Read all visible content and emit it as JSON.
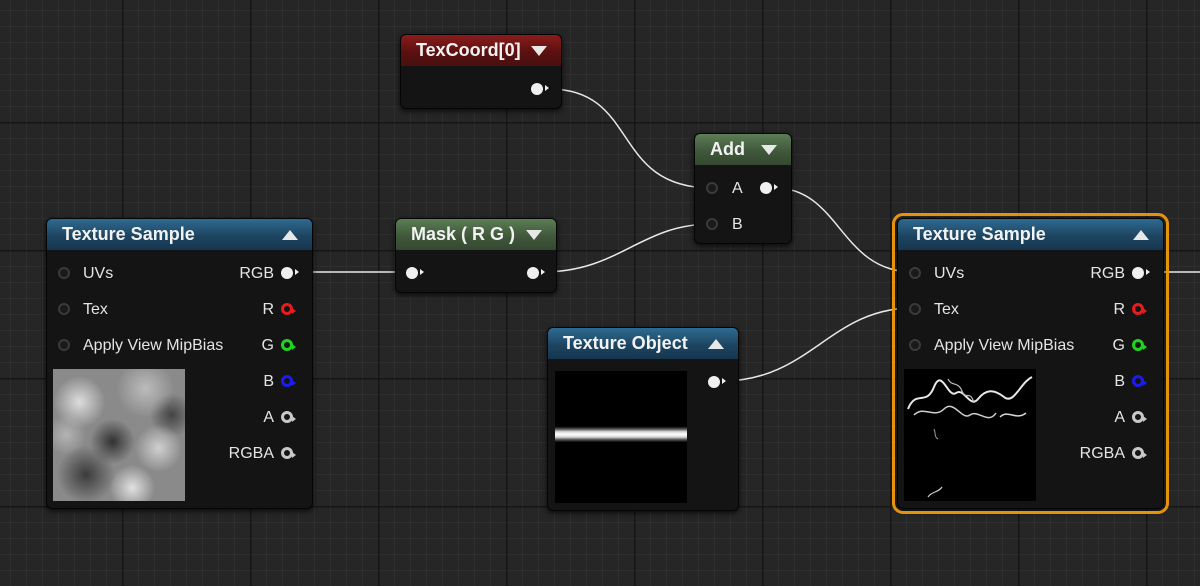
{
  "colors": {
    "rgb_pin": "#f0f0f0",
    "r_pin": "#e81c1c",
    "g_pin": "#1fd41f",
    "b_pin": "#1c1cf0",
    "a_pin": "#c8c8c8",
    "selection": "#e5920d",
    "wire": "#e8e8e8"
  },
  "texcoord_node": {
    "title": "TexCoord[0]"
  },
  "add_node": {
    "title": "Add",
    "input_a": "A",
    "input_b": "B"
  },
  "mask_node": {
    "title": "Mask ( R G )"
  },
  "texture_object_node": {
    "title": "Texture Object"
  },
  "texture_sample_left": {
    "title": "Texture Sample",
    "inputs": [
      "UVs",
      "Tex",
      "Apply View MipBias"
    ],
    "outputs": [
      "RGB",
      "R",
      "G",
      "B",
      "A",
      "RGBA"
    ]
  },
  "texture_sample_right": {
    "title": "Texture Sample",
    "inputs": [
      "UVs",
      "Tex",
      "Apply View MipBias"
    ],
    "outputs": [
      "RGB",
      "R",
      "G",
      "B",
      "A",
      "RGBA"
    ]
  }
}
